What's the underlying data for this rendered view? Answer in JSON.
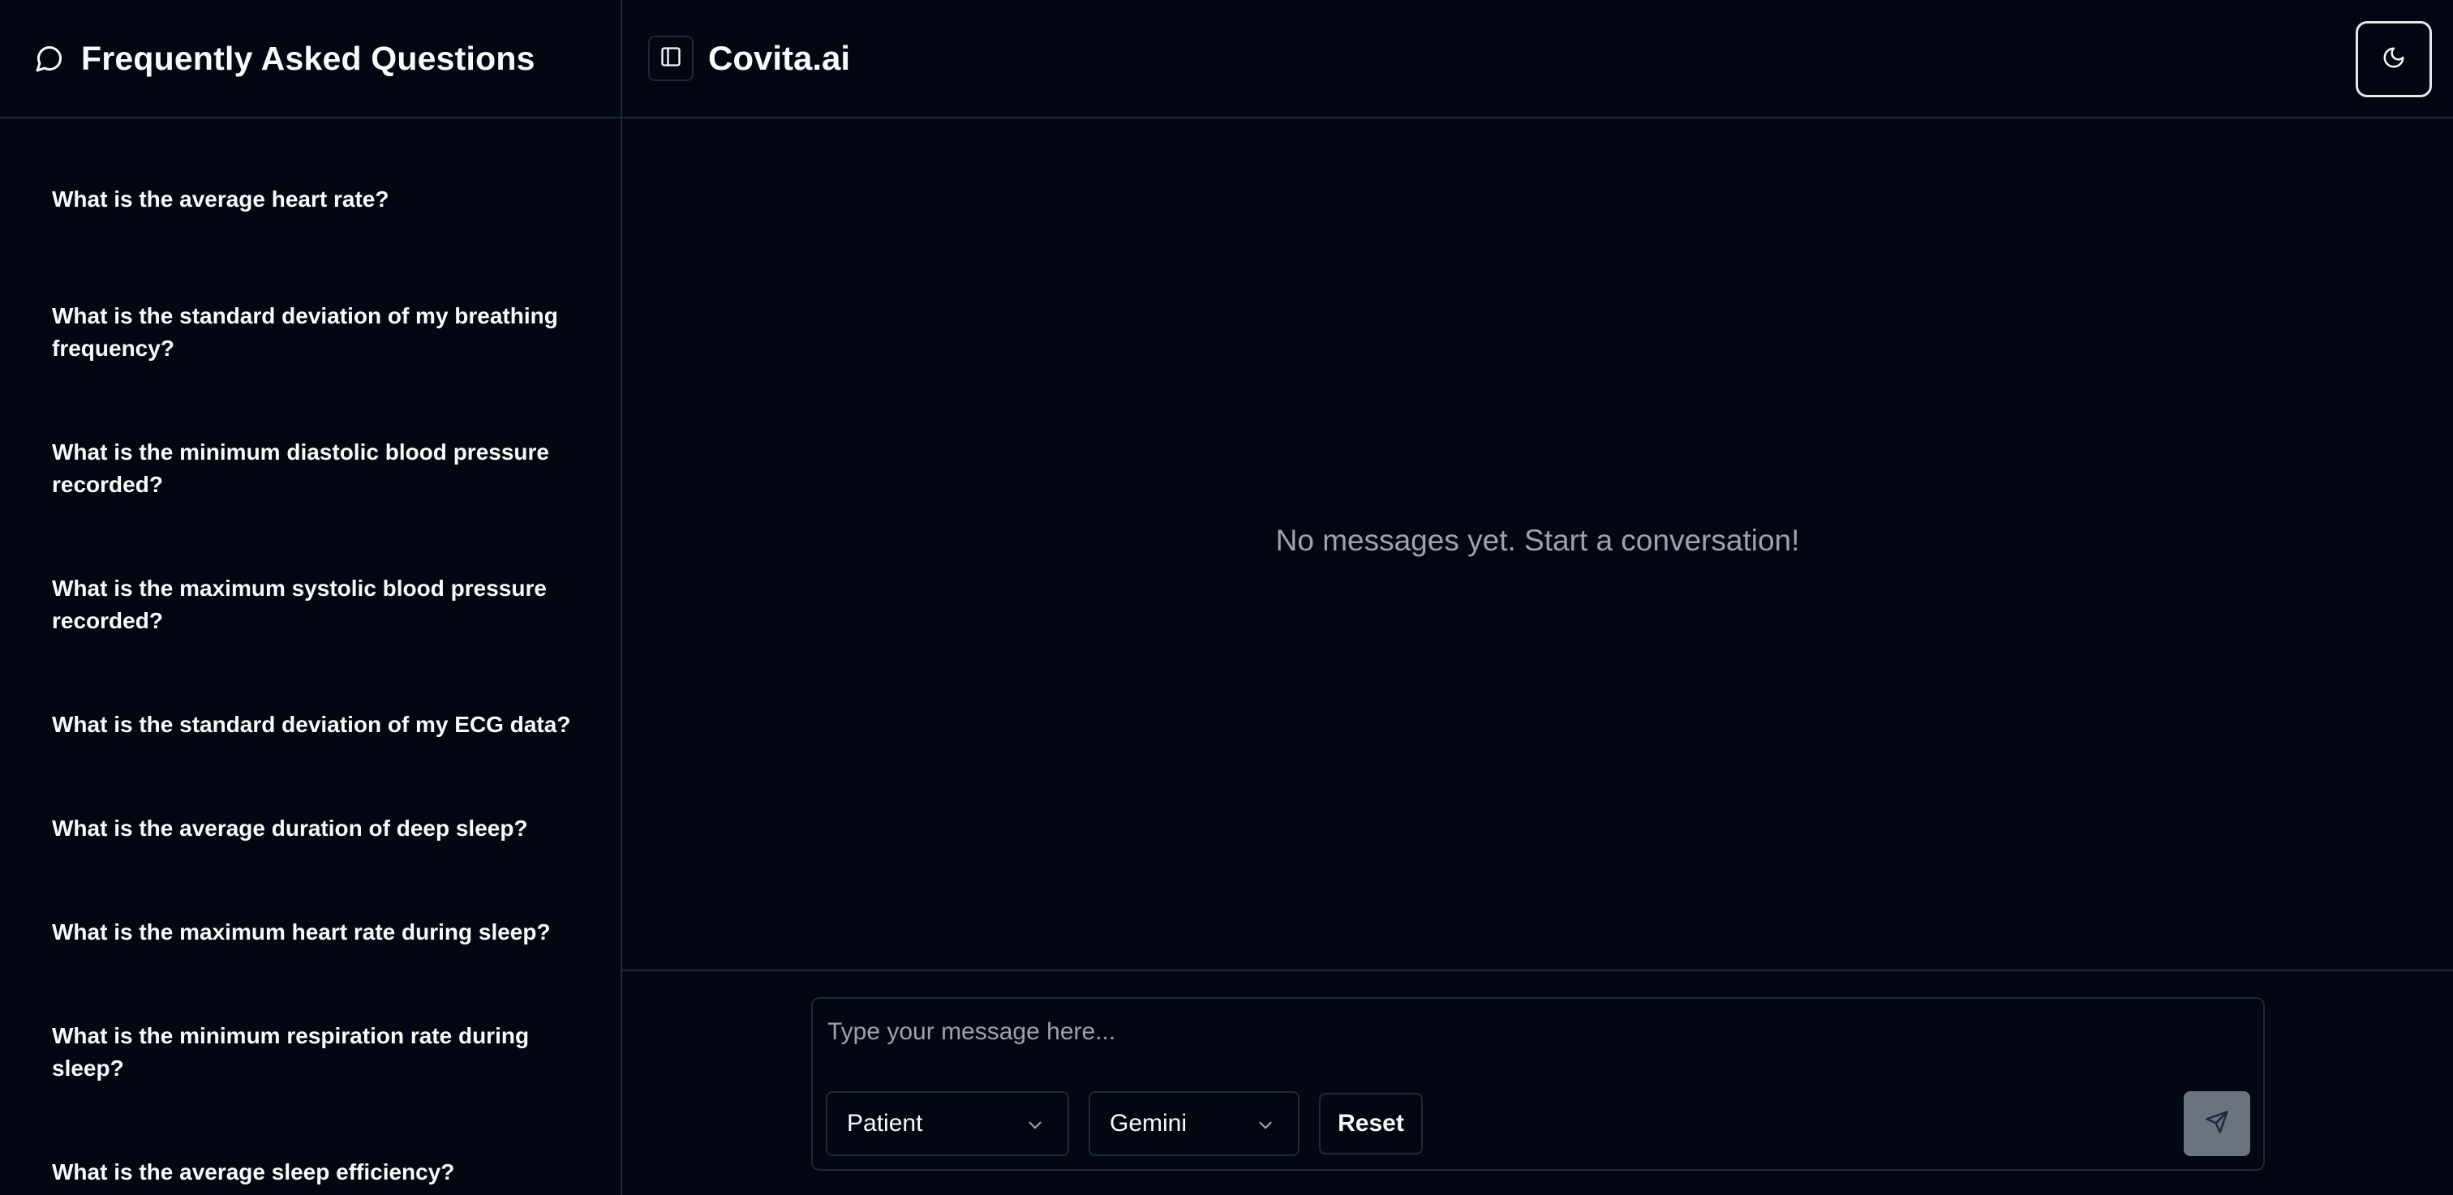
{
  "sidebar": {
    "title": "Frequently Asked Questions",
    "title_icon": "message-circle-icon",
    "items": [
      {
        "label": "What is the average heart rate?"
      },
      {
        "label": "What is the standard deviation of my breathing frequency?"
      },
      {
        "label": "What is the minimum diastolic blood pressure recorded?"
      },
      {
        "label": "What is the maximum systolic blood pressure recorded?"
      },
      {
        "label": "What is the standard deviation of my ECG data?"
      },
      {
        "label": "What is the average duration of deep sleep?"
      },
      {
        "label": "What is the maximum heart rate during sleep?"
      },
      {
        "label": "What is the minimum respiration rate during sleep?"
      },
      {
        "label": "What is the average sleep efficiency?"
      }
    ]
  },
  "header": {
    "brand": "Covita.ai",
    "sidebar_toggle_icon": "panel-left-icon",
    "theme_toggle_icon": "moon-icon"
  },
  "chat": {
    "empty_message": "No messages yet. Start a conversation!"
  },
  "composer": {
    "placeholder": "Type your message here...",
    "role_select": {
      "selected": "Patient"
    },
    "model_select": {
      "selected": "Gemini"
    },
    "reset_label": "Reset",
    "send_icon": "send-icon"
  },
  "colors": {
    "background": "#030712",
    "border": "#1f2937",
    "text": "#f9fafb",
    "muted_text": "#9ca3af",
    "send_button": "#6b7280"
  }
}
